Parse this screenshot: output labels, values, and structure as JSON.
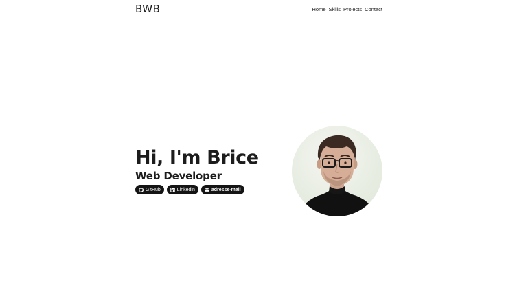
{
  "header": {
    "logo": "BWB",
    "nav": [
      "Home",
      "Skills",
      "Projects",
      "Contact"
    ]
  },
  "hero": {
    "title": "Hi, I'm Brice",
    "subtitle": "Web Developer",
    "links": [
      {
        "label": "GitHub",
        "icon": "github-icon"
      },
      {
        "label": "Linkedin",
        "icon": "linkedin-icon"
      },
      {
        "label": "adresse-mail",
        "icon": "envelope-icon"
      }
    ]
  },
  "colors": {
    "text": "#1c1c1c",
    "pill_background": "#141414",
    "pill_text": "#ffffff",
    "avatar_background": "#e5ebdf"
  }
}
